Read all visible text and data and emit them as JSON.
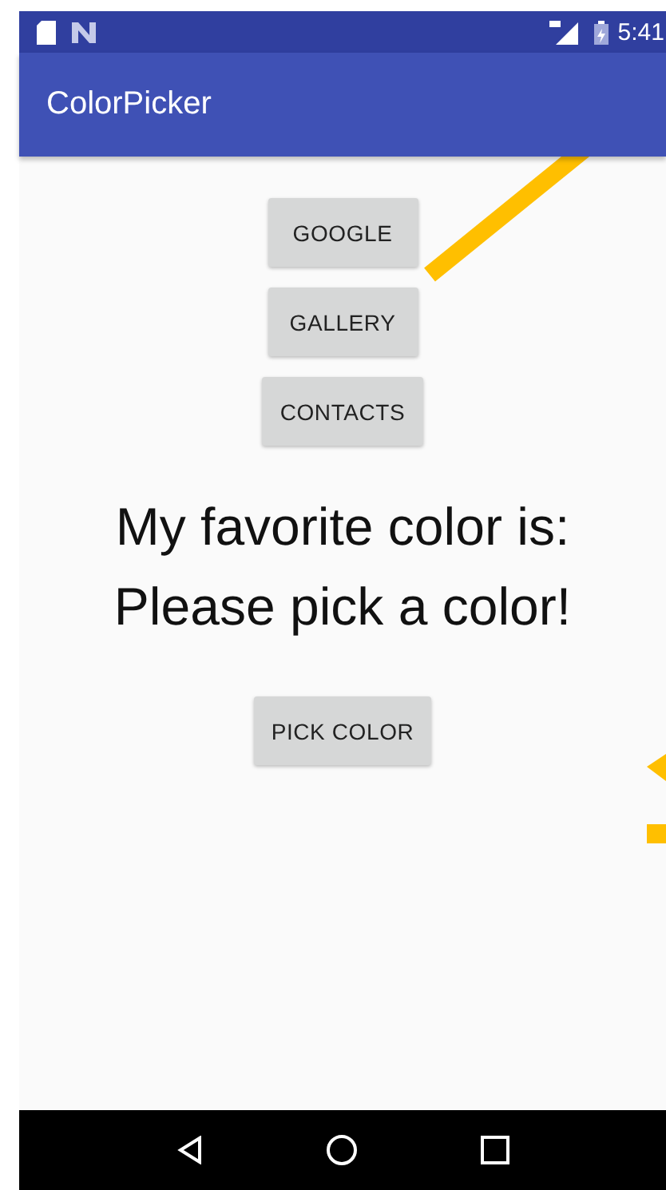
{
  "status_bar": {
    "time": "5:41"
  },
  "app_bar": {
    "title": "ColorPicker"
  },
  "buttons": [
    {
      "label": "GOOGLE"
    },
    {
      "label": "GALLERY"
    },
    {
      "label": "CONTACTS"
    }
  ],
  "heading": "My favorite color is:",
  "message": "Please pick a color!",
  "action_button": {
    "label": "PICK COLOR"
  }
}
